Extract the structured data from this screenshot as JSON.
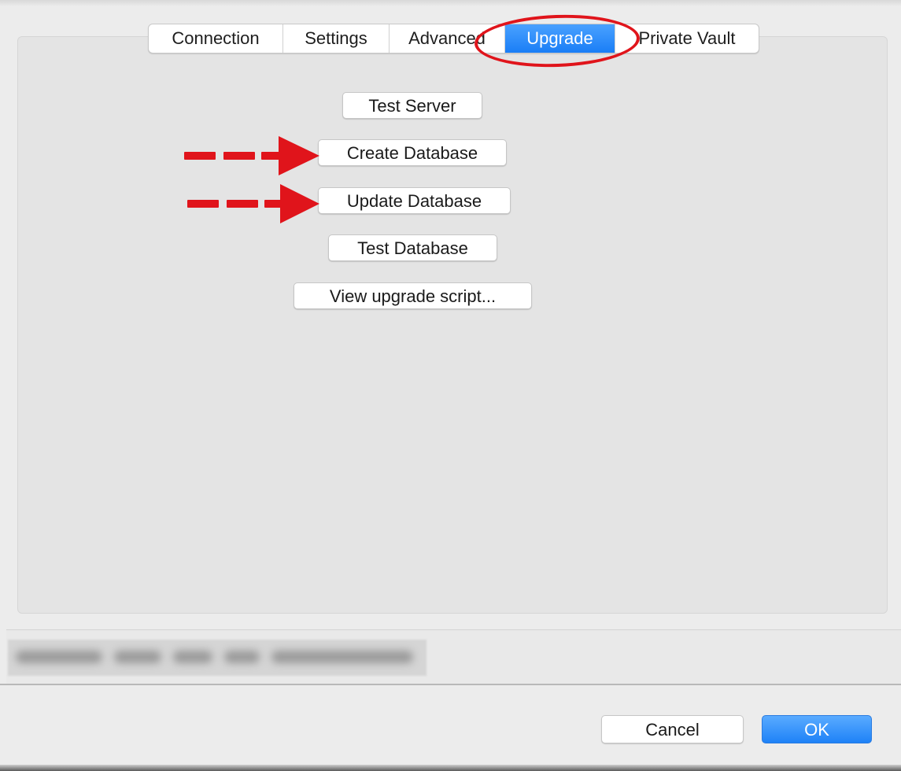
{
  "tabs": {
    "connection": "Connection",
    "settings": "Settings",
    "advanced": "Advanced",
    "upgrade": "Upgrade",
    "private_vault": "Private Vault",
    "active": "Upgrade"
  },
  "actions": {
    "test_server": "Test Server",
    "create_database": "Create Database",
    "update_database": "Update Database",
    "test_database": "Test Database",
    "view_upgrade_script": "View upgrade script..."
  },
  "footer": {
    "cancel_label": "Cancel",
    "ok_label": "OK"
  },
  "annotations": {
    "color": "#e0141b",
    "upgrade_tab_highlight": "red-oval",
    "arrows": [
      "create-database",
      "update-database"
    ]
  },
  "colors": {
    "accent": "#1a7ef6",
    "panel": "#e4e4e4",
    "window": "#ececec"
  }
}
